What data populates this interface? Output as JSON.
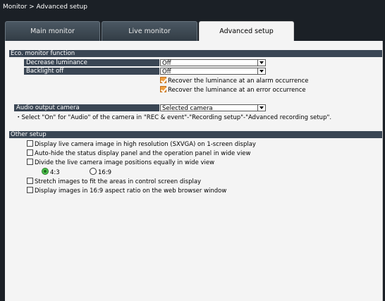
{
  "breadcrumb": "Monitor > Advanced setup",
  "tabs": [
    {
      "label": "Main monitor"
    },
    {
      "label": "Live monitor"
    },
    {
      "label": "Advanced setup",
      "active": true
    }
  ],
  "eco": {
    "heading": "Eco. monitor function",
    "decrease_label": "Decrease luminance",
    "decrease_value": "Off",
    "backlight_label": "Backlight off",
    "backlight_value": "Off",
    "recover_alarm": {
      "label": "Recover the luminance at an alarm occurrence",
      "checked": true
    },
    "recover_error": {
      "label": "Recover the luminance at an error occurrence",
      "checked": true
    }
  },
  "audio": {
    "label": "Audio output camera",
    "value": "Selected camera",
    "note": "・Select \"On\" for \"Audio\" of the camera in \"REC & event\"-\"Recording setup\"-\"Advanced recording setup\"."
  },
  "other": {
    "heading": "Other setup",
    "items": [
      {
        "label": "Display live camera image in high resolution (SXVGA) on 1-screen display",
        "checked": false
      },
      {
        "label": "Auto-hide the status display panel and the operation panel in wide view",
        "checked": false
      },
      {
        "label": "Divide the live camera image positions equally in wide view",
        "checked": false
      },
      {
        "label": "Stretch images to fit the areas in control screen display",
        "checked": false
      },
      {
        "label": "Display images in 16:9 aspect ratio on the web browser window",
        "checked": false
      }
    ],
    "ratio_options": [
      {
        "label": "4:3",
        "selected": true
      },
      {
        "label": "16:9",
        "selected": false
      }
    ]
  },
  "colors": {
    "section_bar": "#3a4654",
    "checked_box": "#f0a040",
    "radio_on": "#4fc34f"
  }
}
